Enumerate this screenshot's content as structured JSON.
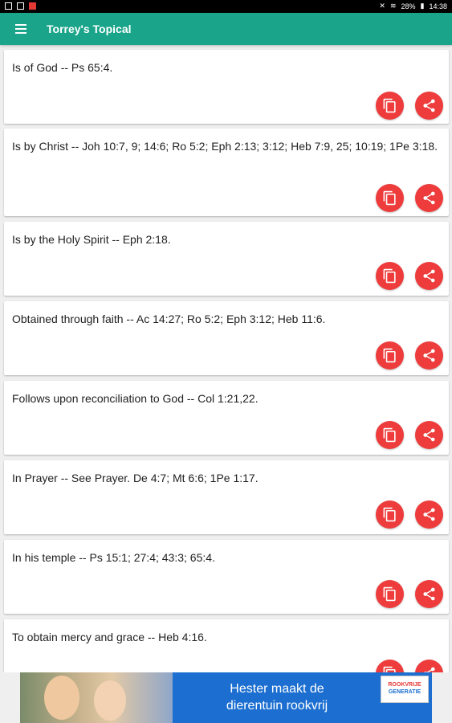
{
  "status_bar": {
    "battery": "28%",
    "time": "14:38"
  },
  "app_bar": {
    "title": "Torrey's Topical"
  },
  "entries": [
    {
      "text": "Is of God -- Ps 65:4."
    },
    {
      "text": "Is by Christ -- Joh 10:7, 9; 14:6; Ro 5:2; Eph 2:13; 3:12; Heb 7:9, 25; 10:19; 1Pe 3:18."
    },
    {
      "text": "Is by the Holy Spirit -- Eph 2:18."
    },
    {
      "text": "Obtained through faith -- Ac 14:27; Ro 5:2; Eph 3:12; Heb 11:6."
    },
    {
      "text": "Follows upon reconciliation to God -- Col 1:21,22."
    },
    {
      "text": "In Prayer -- See Prayer. De 4:7; Mt 6:6; 1Pe 1:17."
    },
    {
      "text": "In his temple -- Ps 15:1; 27:4; 43:3; 65:4."
    },
    {
      "text": "To obtain mercy and grace -- Heb 4:16."
    }
  ],
  "icons": {
    "menu": "menu-icon",
    "copy": "copy-icon",
    "share": "share-icon"
  },
  "colors": {
    "app_bar": "#1aa58a",
    "action_button": "#ee3b3b",
    "status_bar": "#000000",
    "ad_background": "#1c6fd0"
  },
  "ad": {
    "headline_line1": "Hester maakt de",
    "headline_line2": "dierentuin rookvrij",
    "logo_line1": "ROOKVRIJE",
    "logo_line2": "GENERATIE"
  }
}
